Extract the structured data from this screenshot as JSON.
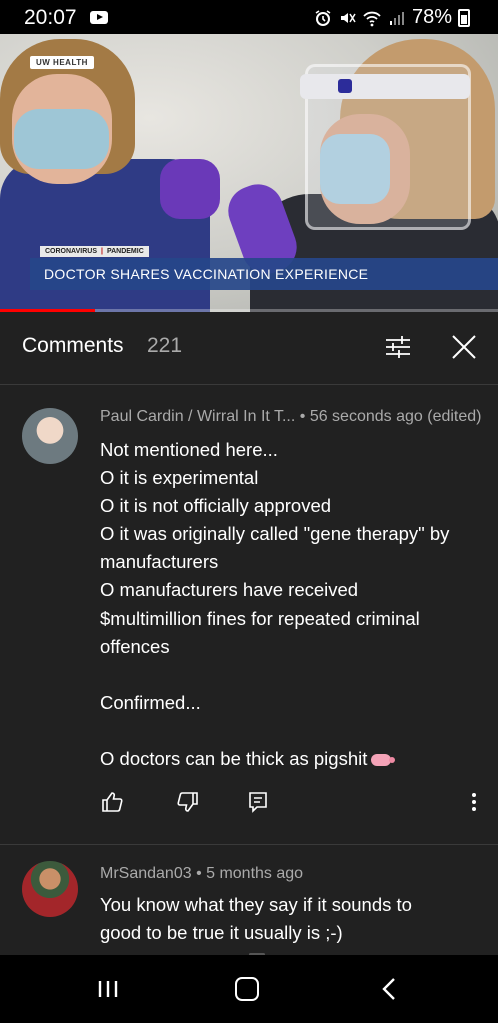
{
  "status_bar": {
    "time": "20:07",
    "battery": "78%",
    "icons": [
      "youtube-icon",
      "alarm-icon",
      "mute-icon",
      "wifi-icon",
      "signal-icon",
      "battery-icon"
    ]
  },
  "video": {
    "corner_logo": "UW HEALTH",
    "tag_left": "CORONAVIRUS",
    "tag_right": "PANDEMIC",
    "headline": "DOCTOR SHARES VACCINATION EXPERIENCE",
    "progress_fraction": 0.19,
    "progress_color": "#ff0000"
  },
  "comments_panel": {
    "title": "Comments",
    "count": "221",
    "filter_icon": "sort-filter-icon",
    "close_icon": "close-icon",
    "comments": [
      {
        "meta": "Paul Cardin / Wirral In It T... • 56 seconds ago (edited)",
        "lines": [
          "Not mentioned here...",
          "O it is experimental",
          "O it is not officially approved",
          "O it was originally called \"gene therapy\" by",
          "manufacturers",
          "O manufacturers have received",
          "$multimillion fines for repeated criminal",
          "offences",
          "",
          "Confirmed...",
          "",
          "O doctors can be thick as pigshit"
        ],
        "emoji": "pig-emoji"
      },
      {
        "meta": "MrSandan03 • 5 months ago",
        "lines": [
          "You know what they say if it sounds to",
          "good to be true it usually is ;-)"
        ]
      }
    ]
  },
  "nav_bar": {
    "icons": [
      "recent-apps-icon",
      "home-icon",
      "back-icon"
    ]
  }
}
